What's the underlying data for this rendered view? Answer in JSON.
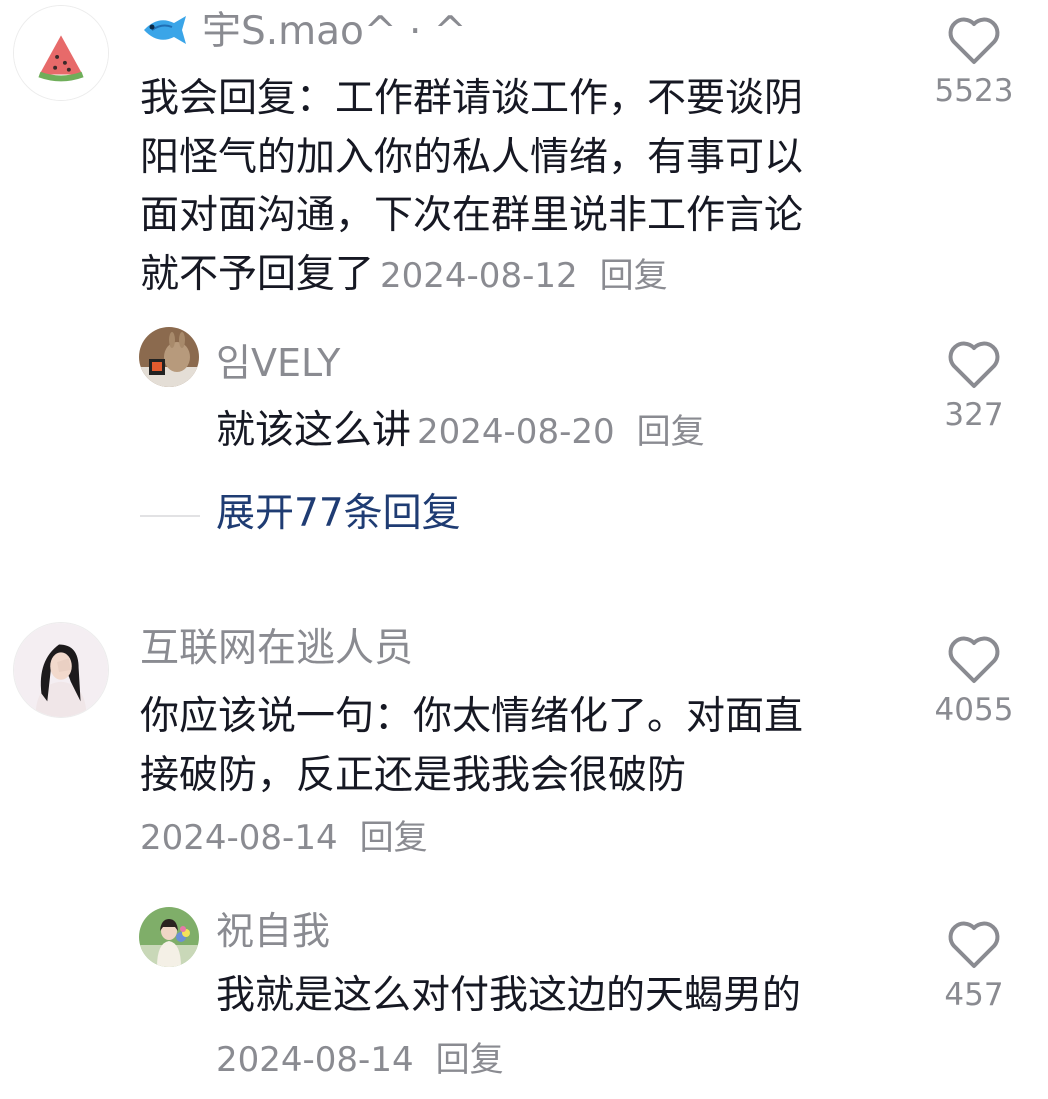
{
  "comments": [
    {
      "username": "宇S.mao^ · ^",
      "text_lines": [
        "我会回复：工作群请谈工作，不要谈阴",
        "阳怪气的加入你的私人情绪，有事可以",
        "面对面沟通，下次在群里说非工作言论",
        "就不予回复了"
      ],
      "date": "2024-08-12",
      "reply_label": "回复",
      "likes": "5523",
      "avatar_icon": "watermelon-icon",
      "name_icon": "fish-emoji-icon"
    },
    {
      "username": "임VELY",
      "text": "就该这么讲",
      "date": "2024-08-20",
      "reply_label": "回复",
      "likes": "327",
      "avatar_icon": "rabbit-photo-avatar"
    },
    {
      "username": "互联网在逃人员",
      "text_lines": [
        "你应该说一句：你太情绪化了。对面直",
        "接破防，反正还是我我会很破防"
      ],
      "date": "2024-08-14",
      "reply_label": "回复",
      "likes": "4055",
      "avatar_icon": "woman-photo-avatar"
    },
    {
      "username": "祝自我",
      "text": "我就是这么对付我这边的天蝎男的",
      "date": "2024-08-14",
      "reply_label": "回复",
      "likes": "457",
      "avatar_icon": "flowers-photo-avatar"
    }
  ],
  "expand_replies": "展开77条回复",
  "colors": {
    "text": "#161823",
    "secondary": "#8a8b91",
    "link": "#1f3c73",
    "background": "#ffffff"
  }
}
